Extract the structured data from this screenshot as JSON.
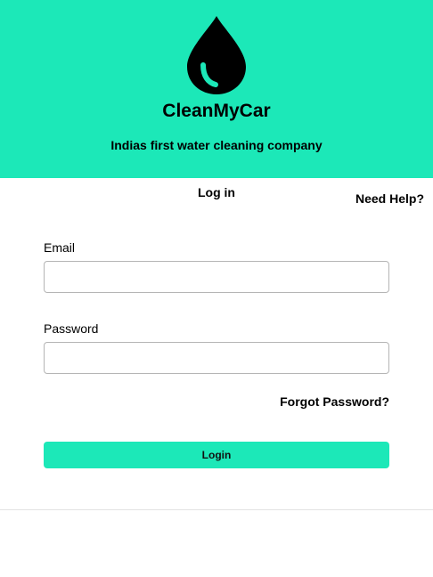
{
  "header": {
    "brand": "CleanMyCar",
    "tagline": "Indias first water cleaning company",
    "logo_icon": "water-drop-icon",
    "background_color": "#1ce8b8"
  },
  "login": {
    "title": "Log in",
    "need_help": "Need Help?",
    "email_label": "Email",
    "email_value": "",
    "password_label": "Password",
    "password_value": "",
    "forgot_password": "Forgot Password?",
    "submit_label": "Login",
    "accent_color": "#1ce8b8"
  }
}
